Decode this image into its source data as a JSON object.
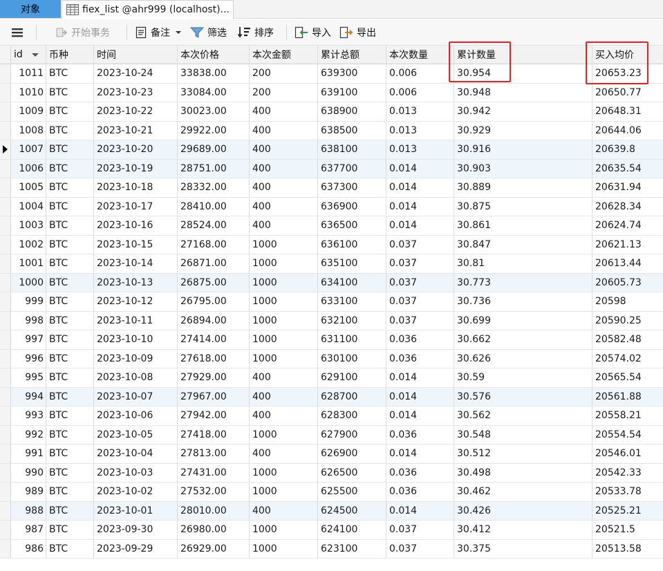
{
  "tabs": {
    "objects_label": "对象",
    "table_tab_label": "fiex_list @ahr999 (localhost)..."
  },
  "toolbar": {
    "menu_icon": "hamburger-icon",
    "begin_transaction_label": "开始事务",
    "memo_label": "备注",
    "filter_label": "筛选",
    "sort_label": "排序",
    "import_label": "导入",
    "export_label": "导出"
  },
  "table": {
    "columns": [
      "id",
      "币种",
      "时间",
      "本次价格",
      "本次金额",
      "累计总额",
      "本次数量",
      "累计数量",
      "买入均价"
    ],
    "selected_row_index": 4,
    "highlighted_columns": [
      "累计数量",
      "买入均价"
    ],
    "highlight_color": "#e8201f",
    "rows": [
      [
        "1011",
        "BTC",
        "2023-10-24",
        "33838.00",
        "200",
        "639300",
        "0.006",
        "30.954",
        "20653.23"
      ],
      [
        "1010",
        "BTC",
        "2023-10-23",
        "33084.00",
        "200",
        "639100",
        "0.006",
        "30.948",
        "20650.77"
      ],
      [
        "1009",
        "BTC",
        "2023-10-22",
        "30023.00",
        "400",
        "638900",
        "0.013",
        "30.942",
        "20648.31"
      ],
      [
        "1008",
        "BTC",
        "2023-10-21",
        "29922.00",
        "400",
        "638500",
        "0.013",
        "30.929",
        "20644.06"
      ],
      [
        "1007",
        "BTC",
        "2023-10-20",
        "29689.00",
        "400",
        "638100",
        "0.013",
        "30.916",
        "20639.8"
      ],
      [
        "1006",
        "BTC",
        "2023-10-19",
        "28751.00",
        "400",
        "637700",
        "0.014",
        "30.903",
        "20635.54"
      ],
      [
        "1005",
        "BTC",
        "2023-10-18",
        "28332.00",
        "400",
        "637300",
        "0.014",
        "30.889",
        "20631.94"
      ],
      [
        "1004",
        "BTC",
        "2023-10-17",
        "28410.00",
        "400",
        "636900",
        "0.014",
        "30.875",
        "20628.34"
      ],
      [
        "1003",
        "BTC",
        "2023-10-16",
        "28524.00",
        "400",
        "636500",
        "0.014",
        "30.861",
        "20624.74"
      ],
      [
        "1002",
        "BTC",
        "2023-10-15",
        "27168.00",
        "1000",
        "636100",
        "0.037",
        "30.847",
        "20621.13"
      ],
      [
        "1001",
        "BTC",
        "2023-10-14",
        "26871.00",
        "1000",
        "635100",
        "0.037",
        "30.81",
        "20613.44"
      ],
      [
        "1000",
        "BTC",
        "2023-10-13",
        "26875.00",
        "1000",
        "634100",
        "0.037",
        "30.773",
        "20605.73"
      ],
      [
        "999",
        "BTC",
        "2023-10-12",
        "26795.00",
        "1000",
        "633100",
        "0.037",
        "30.736",
        "20598"
      ],
      [
        "998",
        "BTC",
        "2023-10-11",
        "26894.00",
        "1000",
        "632100",
        "0.037",
        "30.699",
        "20590.25"
      ],
      [
        "997",
        "BTC",
        "2023-10-10",
        "27414.00",
        "1000",
        "631100",
        "0.036",
        "30.662",
        "20582.48"
      ],
      [
        "996",
        "BTC",
        "2023-10-09",
        "27618.00",
        "1000",
        "630100",
        "0.036",
        "30.626",
        "20574.02"
      ],
      [
        "995",
        "BTC",
        "2023-10-08",
        "27929.00",
        "400",
        "629100",
        "0.014",
        "30.59",
        "20565.54"
      ],
      [
        "994",
        "BTC",
        "2023-10-07",
        "27967.00",
        "400",
        "628700",
        "0.014",
        "30.576",
        "20561.88"
      ],
      [
        "993",
        "BTC",
        "2023-10-06",
        "27942.00",
        "400",
        "628300",
        "0.014",
        "30.562",
        "20558.21"
      ],
      [
        "992",
        "BTC",
        "2023-10-05",
        "27418.00",
        "1000",
        "627900",
        "0.036",
        "30.548",
        "20554.54"
      ],
      [
        "991",
        "BTC",
        "2023-10-04",
        "27813.00",
        "400",
        "626900",
        "0.014",
        "30.512",
        "20546.01"
      ],
      [
        "990",
        "BTC",
        "2023-10-03",
        "27431.00",
        "1000",
        "626500",
        "0.036",
        "30.498",
        "20542.33"
      ],
      [
        "989",
        "BTC",
        "2023-10-02",
        "27532.00",
        "1000",
        "625500",
        "0.036",
        "30.462",
        "20533.78"
      ],
      [
        "988",
        "BTC",
        "2023-10-01",
        "28010.00",
        "400",
        "624500",
        "0.014",
        "30.426",
        "20525.21"
      ],
      [
        "987",
        "BTC",
        "2023-09-30",
        "26980.00",
        "1000",
        "624100",
        "0.037",
        "30.412",
        "20521.5"
      ],
      [
        "986",
        "BTC",
        "2023-09-29",
        "26929.00",
        "1000",
        "623100",
        "0.037",
        "30.375",
        "20513.58"
      ]
    ]
  }
}
